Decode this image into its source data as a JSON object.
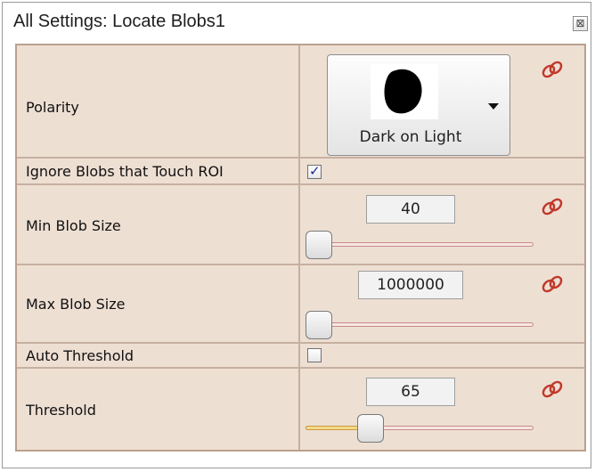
{
  "window": {
    "title": "All Settings: Locate Blobs1",
    "close_label": "⊠"
  },
  "settings": {
    "polarity": {
      "label": "Polarity",
      "value": "Dark on Light",
      "icon": "blob-preview-icon"
    },
    "ignore_touch_roi": {
      "label": "Ignore Blobs that Touch ROI",
      "checked": true,
      "check_glyph": "✓"
    },
    "min_blob_size": {
      "label": "Min Blob Size",
      "value": "40",
      "slider_fraction": 0.0
    },
    "max_blob_size": {
      "label": "Max Blob Size",
      "value": "1000000",
      "slider_fraction": 0.0
    },
    "auto_threshold": {
      "label": "Auto Threshold",
      "checked": false
    },
    "threshold": {
      "label": "Threshold",
      "value": "65",
      "slider_fraction": 0.26
    }
  },
  "colors": {
    "grid_background": "#eedfd3",
    "link_icon": "#c0392b"
  }
}
